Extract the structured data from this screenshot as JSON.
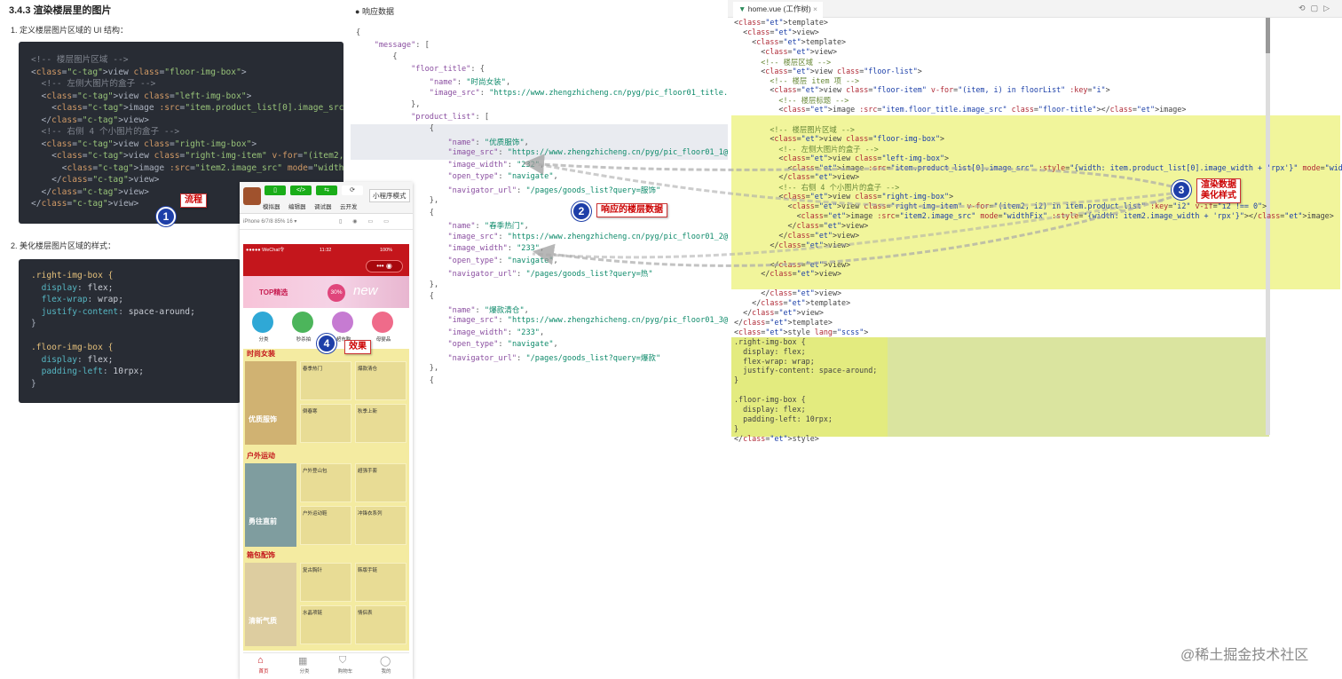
{
  "doc": {
    "heading": "3.4.3 渲染楼层里的图片",
    "step1": "1. 定义楼层图片区域的 UI 结构：",
    "step2": "2. 美化楼层图片区域的样式：",
    "html_lines": [
      "<!-- 楼层图片区域 -->",
      "<view class=\"floor-img-box\">",
      "  <!-- 左侧大图片的盒子 -->",
      "  <view class=\"left-img-box\">",
      "    <image :src=\"item.product_list[0].image_src\" :style=\"{width: ite",
      "  </view>",
      "  <!-- 右侧 4 个小图片的盒子 -->",
      "  <view class=\"right-img-box\">",
      "    <view class=\"right-img-item\" v-for=\"(item2, i2) in item.product_",
      "      <image :src=\"item2.image_src\" mode=\"widthFix\" :style=\"{width:",
      "    </view>",
      "  </view>",
      "</view>"
    ],
    "css_lines": [
      ".right-img-box {",
      "  display: flex;",
      "  flex-wrap: wrap;",
      "  justify-content: space-around;",
      "}",
      "",
      ".floor-img-box {",
      "  display: flex;",
      "  padding-left: 10rpx;",
      "}"
    ]
  },
  "json_panel": {
    "title": "响应数据",
    "lines": [
      "{",
      "    \"message\": [",
      "        {",
      "            \"floor_title\": {",
      "                \"name\": \"时尚女装\",",
      "                \"image_src\": \"https://www.zhengzhicheng.cn/pyg/pic_floor01_title.png\"",
      "            },",
      "            \"product_list\": [",
      "                {",
      "                    \"name\": \"优质服饰\",",
      "                    \"image_src\": \"https://www.zhengzhicheng.cn/pyg/pic_floor01_1@2x.png",
      "                    \"image_width\": \"232\",",
      "                    \"open_type\": \"navigate\",",
      "                    \"navigator_url\": \"/pages/goods_list?query=服饰\"",
      "                },",
      "                {",
      "                    \"name\": \"春季热门\",",
      "                    \"image_src\": \"https://www.zhengzhicheng.cn/pyg/pic_floor01_2@2x.png",
      "                    \"image_width\": \"233\",",
      "                    \"open_type\": \"navigate\",",
      "                    \"navigator_url\": \"/pages/goods_list?query=热\"",
      "                },",
      "                {",
      "                    \"name\": \"爆款清仓\",",
      "                    \"image_src\": \"https://www.zhengzhicheng.cn/pyg/pic_floor01_3@2x.png",
      "                    \"image_width\": \"233\",",
      "                    \"open_type\": \"navigate\",",
      "                    \"navigator_url\": \"/pages/goods_list?query=爆款\"",
      "                },",
      "                {"
    ]
  },
  "editor": {
    "tab": "home.vue (工作树)",
    "lines": [
      "<template>",
      "  <view>",
      "    <template>",
      "      <view>",
      "      <!-- 楼层区域 -->",
      "      <view class=\"floor-list\">",
      "        <!-- 楼层 item 项 -->",
      "        <view class=\"floor-item\" v-for=\"(item, i) in floorList\" :key=\"i\">",
      "          <!-- 楼层标题 -->",
      "          <image :src=\"item.floor_title.image_src\" class=\"floor-title\"></image>",
      "",
      "        <!-- 楼层图片区域 -->",
      "        <view class=\"floor-img-box\">",
      "          <!-- 左侧大图片的盒子 -->",
      "          <view class=\"left-img-box\">",
      "            <image :src=\"item.product_list[0].image_src\" :style=\"{width: item.product_list[0].image_width + 'rpx'}\" mode=\"widthFix\"></image>",
      "          </view>",
      "          <!-- 右侧 4 个小图片的盒子 -->",
      "          <view class=\"right-img-box\">",
      "            <view class=\"right-img-item\" v-for=\"(item2, i2) in item.product_list\" :key=\"i2\" v-if=\"i2 !== 0\">",
      "              <image :src=\"item2.image_src\" mode=\"widthFix\" :style=\"{width: item2.image_width + 'rpx'}\"></image>",
      "            </view>",
      "          </view>",
      "        </view>",
      "",
      "        </view>",
      "      </view>",
      "",
      "      </view>",
      "    </template>",
      "  </view>",
      "</template>",
      "<style lang=\"scss\">",
      ".right-img-box {",
      "  display: flex;",
      "  flex-wrap: wrap;",
      "  justify-content: space-around;",
      "}",
      "",
      ".floor-img-box {",
      "  display: flex;",
      "  padding-left: 10rpx;",
      "}",
      "</style>"
    ]
  },
  "phone": {
    "toolbar": [
      "模拟器",
      "编辑器",
      "调试器",
      "云开发"
    ],
    "mode": "小程序模式",
    "device": "iPhone 6/7/8 85% 16 ▾",
    "carrier": "●●●●● WeChat令",
    "time": "11:32",
    "battery": "100%",
    "banner_text": "TOP精选",
    "banner_pct": "30%",
    "banner_new": "new",
    "nav": [
      "分类",
      "秒杀拍",
      "超市购",
      "母婴品"
    ],
    "floors": [
      {
        "title": "时尚女装",
        "big": "优质服饰",
        "small": [
          "春季热门",
          "爆款清仓",
          "倒春寒",
          "秋季上新"
        ]
      },
      {
        "title": "户外运动",
        "big": "勇往直前",
        "small": [
          "户外登山包",
          "超强手套",
          "户外运动鞋",
          "冲锋衣系列"
        ]
      },
      {
        "title": "箱包配饰",
        "big": "清新气质",
        "small": [
          "复古胸针",
          "韩版手链",
          "水晶项链",
          "情侣表"
        ]
      }
    ],
    "tabbar": [
      "首页",
      "分类",
      "购物车",
      "我的"
    ]
  },
  "annotations": [
    {
      "num": "1",
      "label": "流程"
    },
    {
      "num": "2",
      "label": "响应的楼层数据"
    },
    {
      "num": "3",
      "label": "渲染数据\n美化样式"
    },
    {
      "num": "4",
      "label": "效果"
    }
  ],
  "watermark": "@稀土掘金技术社区",
  "colors": {
    "code_bg": "#282c34",
    "highlight": "#eef38a",
    "badge": "#1e3fa8",
    "brand_red": "#c4161c"
  }
}
